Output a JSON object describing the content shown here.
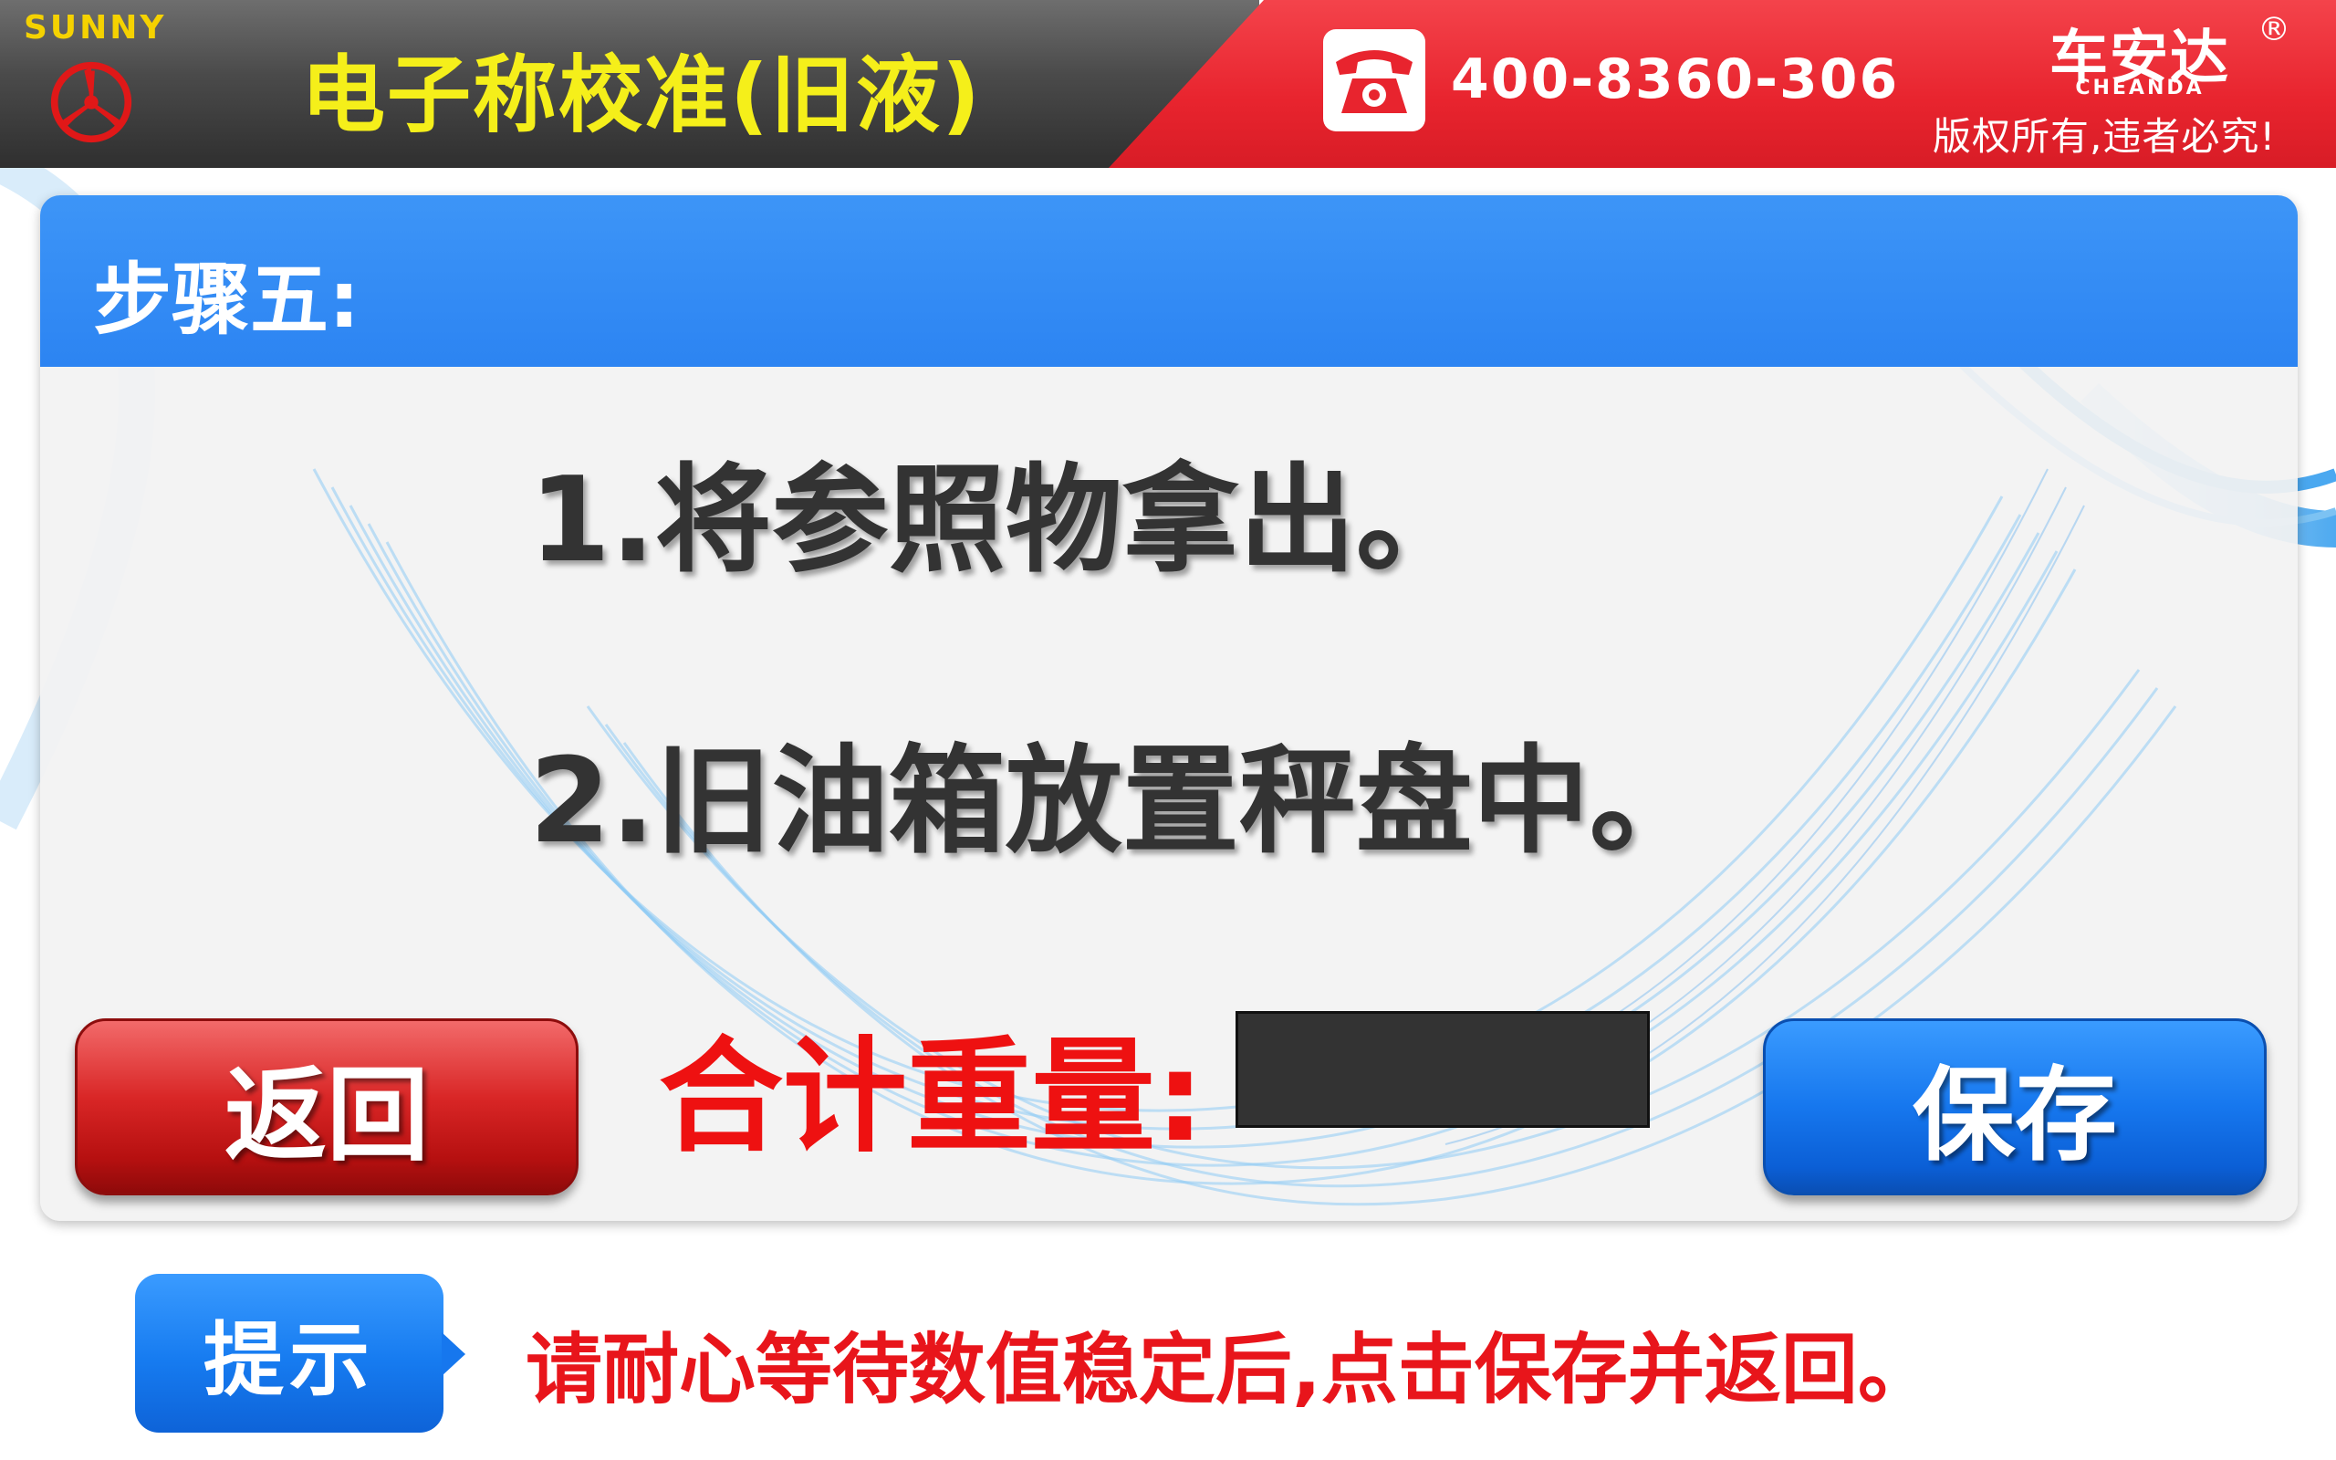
{
  "header": {
    "brand_en": "SUNNY",
    "title": "电子称校准(旧液)",
    "phone_number": "400-8360-306",
    "brand_cn": "车安达",
    "brand_reg": "®",
    "brand_en_sub": "CHEANDA",
    "copyright": "版权所有,违者必究!"
  },
  "panel": {
    "step_title": "步骤五:",
    "instructions": [
      "1.将参照物拿出。",
      "2.旧油箱放置秤盘中。"
    ],
    "total_label": "合计重量:",
    "weight_value": ""
  },
  "buttons": {
    "back_label": "返回",
    "save_label": "保存"
  },
  "hint": {
    "label": "提示",
    "text": "请耐心等待数值稳定后,点击保存并返回。"
  },
  "colors": {
    "title_yellow": "#f5ef1a",
    "header_red": "#e8242e",
    "panel_blue": "#2c84f2",
    "back_red": "#d92626",
    "save_blue": "#1677ee",
    "alert_red": "#ee1111"
  },
  "icons": [
    "sunny-logo-icon",
    "telephone-icon"
  ]
}
